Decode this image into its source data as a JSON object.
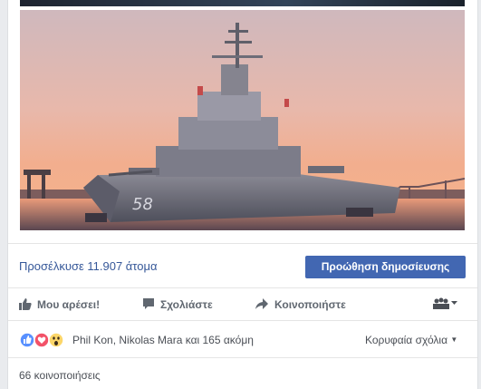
{
  "post": {
    "image_alt_main": "Warship with hull number 58 at dusk",
    "hull_number": "58"
  },
  "promotion": {
    "reach_text": "Προσέλκυσε 11.907 άτομα",
    "boost_label": "Προώθηση δημοσίευσης"
  },
  "actions": {
    "like": "Μου αρέσει!",
    "comment": "Σχολιάστε",
    "share": "Κοινοποιήστε"
  },
  "reactions": {
    "summary": "Phil Kon, Nikolas Mara και 165 ακόμη",
    "sort_label": "Κορυφαία σχόλια",
    "types": [
      "like",
      "love",
      "wow"
    ]
  },
  "shares": {
    "count_text": "66 κοινοποιήσεις"
  },
  "colors": {
    "link": "#365899",
    "button_bg": "#4267b2",
    "action_text": "#606770",
    "like_blue": "#5890ff",
    "love_red": "#f25268",
    "wow_yellow": "#fcd669"
  }
}
